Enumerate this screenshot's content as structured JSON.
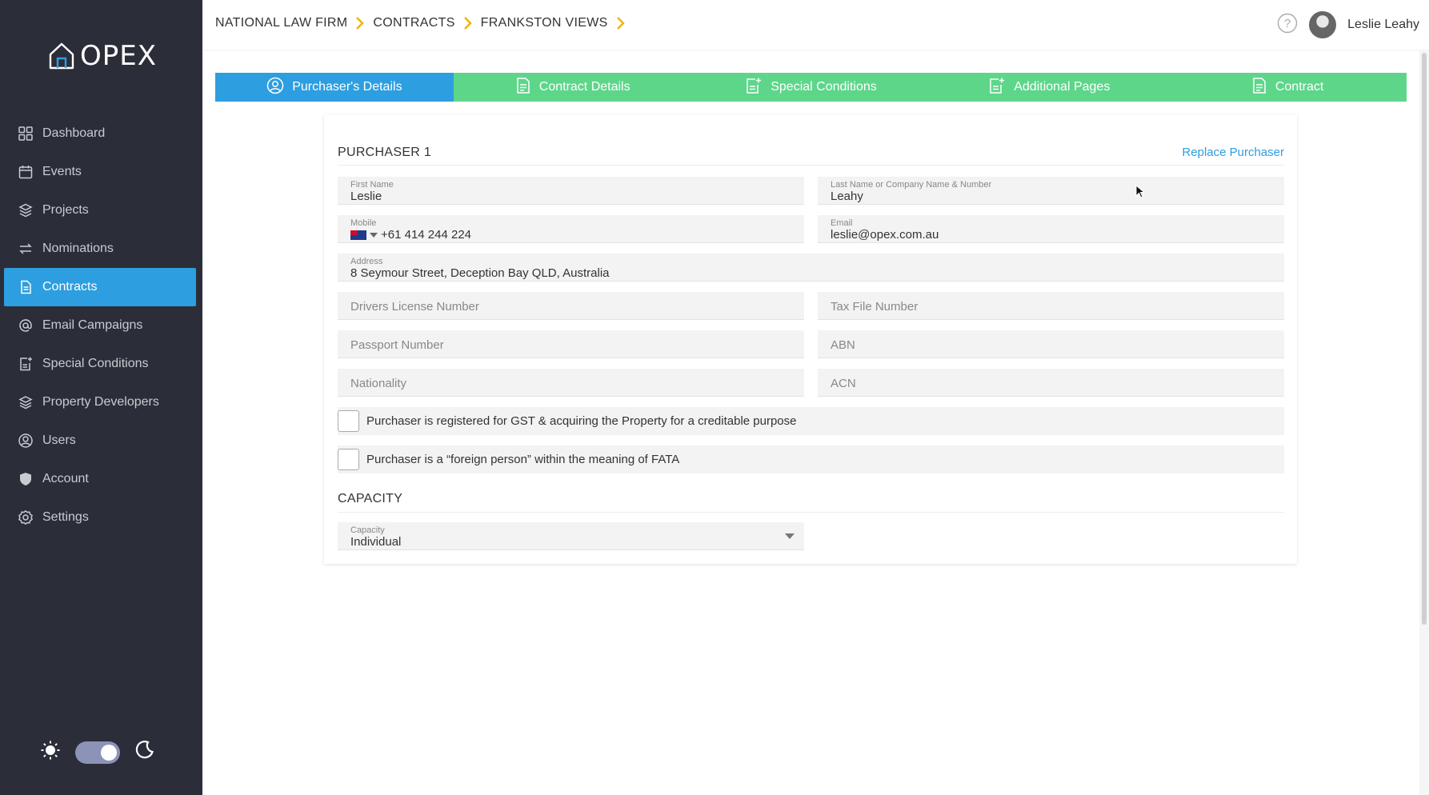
{
  "brand": {
    "name": "OPEX"
  },
  "sidebar": {
    "items": [
      {
        "label": "Dashboard",
        "icon": "grid-icon"
      },
      {
        "label": "Events",
        "icon": "calendar-icon"
      },
      {
        "label": "Projects",
        "icon": "layers-icon"
      },
      {
        "label": "Nominations",
        "icon": "swap-icon"
      },
      {
        "label": "Contracts",
        "icon": "document-icon",
        "active": true
      },
      {
        "label": "Email Campaigns",
        "icon": "at-icon"
      },
      {
        "label": "Special Conditions",
        "icon": "document-plus-icon"
      },
      {
        "label": "Property Developers",
        "icon": "stack-icon"
      },
      {
        "label": "Users",
        "icon": "user-circle-icon"
      },
      {
        "label": "Account",
        "icon": "shield-icon"
      },
      {
        "label": "Settings",
        "icon": "gear-icon"
      }
    ],
    "theme_toggle": {
      "mode": "dark"
    }
  },
  "header": {
    "breadcrumbs": [
      "NATIONAL LAW FIRM",
      "CONTRACTS",
      "FRANKSTON VIEWS"
    ],
    "user_name": "Leslie Leahy"
  },
  "steps": [
    {
      "label": "Purchaser's Details",
      "active": true
    },
    {
      "label": "Contract Details"
    },
    {
      "label": "Special Conditions"
    },
    {
      "label": "Additional Pages"
    },
    {
      "label": "Contract"
    }
  ],
  "form": {
    "section_title": "PURCHASER 1",
    "replace_label": "Replace Purchaser",
    "first_name": {
      "label": "First Name",
      "value": "Leslie"
    },
    "last_name": {
      "label": "Last Name or Company Name & Number",
      "value": "Leahy"
    },
    "mobile": {
      "label": "Mobile",
      "value": "+61 414 244 224"
    },
    "email": {
      "label": "Email",
      "value": "leslie@opex.com.au"
    },
    "address": {
      "label": "Address",
      "value": "8 Seymour Street, Deception Bay QLD, Australia"
    },
    "drivers_license": {
      "placeholder": "Drivers License Number"
    },
    "tax_file": {
      "placeholder": "Tax File Number"
    },
    "passport": {
      "placeholder": "Passport Number"
    },
    "abn": {
      "placeholder": "ABN"
    },
    "nationality": {
      "placeholder": "Nationality"
    },
    "acn": {
      "placeholder": "ACN"
    },
    "gst_checkbox": {
      "label": "Purchaser is registered for GST & acquiring the Property for a creditable purpose",
      "checked": false
    },
    "fata_checkbox": {
      "label": "Purchaser is a “foreign person” within the meaning of FATA",
      "checked": false
    },
    "capacity_title": "CAPACITY",
    "capacity": {
      "label": "Capacity",
      "value": "Individual"
    }
  },
  "colors": {
    "accent": "#2d9ee0",
    "step_green": "#5dd68a",
    "sidebar_bg": "#2b2e38"
  }
}
